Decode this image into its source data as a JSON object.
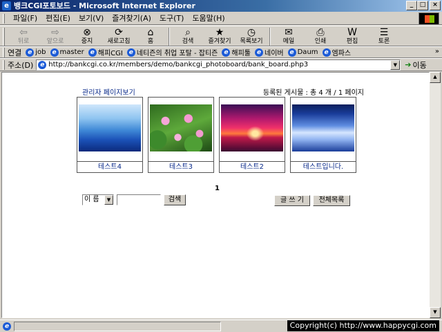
{
  "window": {
    "title": "뱅크CGI포토보드 - Microsoft Internet Explorer",
    "buttons": [
      "_",
      "□",
      "×"
    ]
  },
  "menu": [
    "파일(F)",
    "편집(E)",
    "보기(V)",
    "즐겨찾기(A)",
    "도구(T)",
    "도움말(H)"
  ],
  "toolbar": [
    {
      "label": "뒤로",
      "icon": "back-arrow-icon",
      "glyph": "⇦",
      "disabled": true
    },
    {
      "label": "앞으로",
      "icon": "forward-arrow-icon",
      "glyph": "⇨",
      "disabled": true
    },
    {
      "label": "중지",
      "icon": "stop-icon",
      "glyph": "⊗",
      "disabled": false
    },
    {
      "label": "새로고침",
      "icon": "refresh-icon",
      "glyph": "⟳",
      "disabled": false
    },
    {
      "label": "홈",
      "icon": "home-icon",
      "glyph": "⌂",
      "disabled": false
    },
    {
      "label": "검색",
      "icon": "search-icon",
      "glyph": "⌕",
      "disabled": false
    },
    {
      "label": "즐겨찾기",
      "icon": "favorites-icon",
      "glyph": "★",
      "disabled": false
    },
    {
      "label": "목록보기",
      "icon": "history-icon",
      "glyph": "◷",
      "disabled": false
    },
    {
      "label": "메일",
      "icon": "mail-icon",
      "glyph": "✉",
      "disabled": false
    },
    {
      "label": "인쇄",
      "icon": "print-icon",
      "glyph": "⎙",
      "disabled": false
    },
    {
      "label": "편집",
      "icon": "edit-icon",
      "glyph": "W",
      "disabled": false
    },
    {
      "label": "토론",
      "icon": "discuss-icon",
      "glyph": "☰",
      "disabled": false
    }
  ],
  "links": {
    "label": "연결",
    "items": [
      "job",
      "master",
      "해피CGI",
      "네티즌의 취업 포탈 - 잡티즌",
      "해피툴",
      "네이버",
      "Daum",
      "엠파스"
    ],
    "more": "»"
  },
  "address": {
    "label": "주소(D)",
    "url": "http://bankcgi.co.kr/members/demo/bankcgi_photoboard/bank_board.php3",
    "go_label": "이동"
  },
  "board": {
    "admin_link": "관리자 페이지보기",
    "post_count": "등록된 게시물 : 총 4 개 / 1 페이지",
    "posts": [
      {
        "title": "테스트4",
        "image": "mountains"
      },
      {
        "title": "테스트3",
        "image": "lotus"
      },
      {
        "title": "테스트2",
        "image": "sunset"
      },
      {
        "title": "테스트입니다.",
        "image": "waterfall"
      }
    ],
    "page": "1",
    "search_field": "이 름",
    "search_button": "검색",
    "write_button": "글 쓰 기",
    "list_button": "전체목록"
  },
  "status": {
    "copyright": "Copyright(c) http://www.happycgi.com"
  }
}
